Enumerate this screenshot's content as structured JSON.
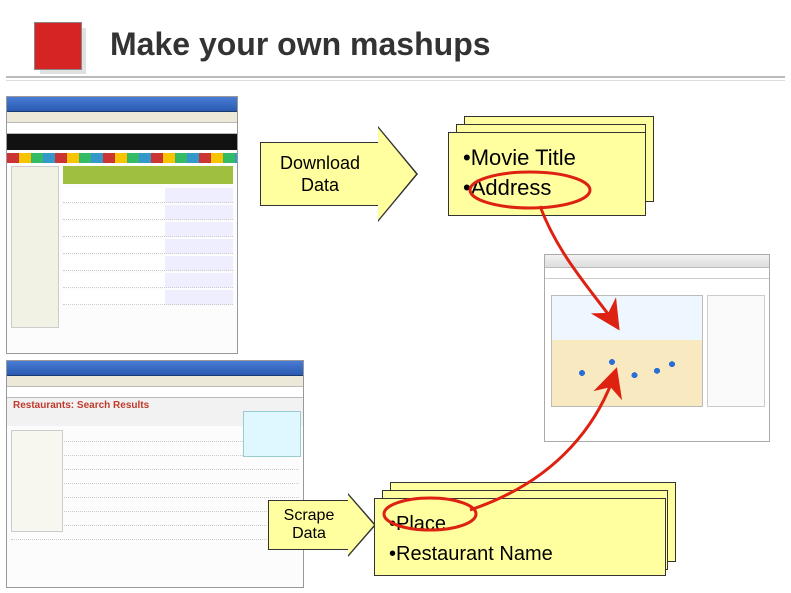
{
  "title": "Make your own mashups",
  "arrow1": {
    "line1": "Download",
    "line2": "Data"
  },
  "arrow2": {
    "line1": "Scrape",
    "line2": "Data"
  },
  "note1": {
    "bullet1": {
      "marker": "•",
      "text": "Movie Title"
    },
    "bullet2": {
      "marker": "•",
      "text": "Address"
    }
  },
  "note2": {
    "bullet1": {
      "marker": "•",
      "text": "Place"
    },
    "bullet2": {
      "marker": "•",
      "text": "Restaurant Name"
    }
  },
  "shot2_header": "Restaurants: Search Results",
  "circled_in_note1": "Address",
  "circled_in_note2": "Place"
}
